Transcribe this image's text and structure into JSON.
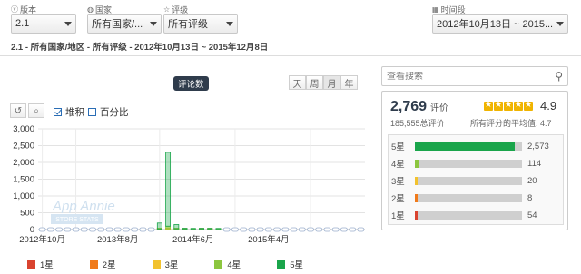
{
  "filters": {
    "version": {
      "label": "版本",
      "icon": "version-icon",
      "value": "2.1"
    },
    "country": {
      "label": "国家",
      "icon": "globe-icon",
      "value": "所有国家/..."
    },
    "rating": {
      "label": "评级",
      "icon": "star-icon",
      "value": "所有评级"
    },
    "period": {
      "label": "时间段",
      "icon": "calendar-icon",
      "value": "2012年10月13日 ~ 2015..."
    }
  },
  "summary_line": "2.1 - 所有国家/地区 - 所有评级 - 2012年10月13日 ~ 2015年12月8日",
  "chart_header": {
    "badge": "评论数",
    "range_buttons": [
      "天",
      "周",
      "月",
      "年"
    ],
    "stacked_label": "堆积",
    "stacked_checked": true,
    "percent_label": "百分比",
    "percent_checked": false
  },
  "watermark": {
    "line1": "App Annie",
    "line2": "STORE STATS"
  },
  "chart_data": {
    "type": "bar",
    "stacked": true,
    "x_tick_labels": [
      "2012年10月",
      "2013年8月",
      "2014年6月",
      "2015年4月"
    ],
    "y_ticks": [
      0,
      500,
      1000,
      1500,
      2000,
      2500,
      3000
    ],
    "y_tick_labels": [
      "0",
      "500",
      "1,000",
      "1,500",
      "2,000",
      "2,500",
      "3,000"
    ],
    "ylim": [
      0,
      3000
    ],
    "grid": true,
    "legend_position": "bottom",
    "colors": {
      "1星": "#d9432f",
      "2星": "#f07a1a",
      "3星": "#f2c22e",
      "4星": "#8cc63f",
      "5星": "#1aa54b"
    },
    "series": [
      {
        "name": "1星",
        "values": [
          0,
          0,
          0,
          0,
          0,
          0,
          0,
          0,
          0,
          0,
          0,
          0,
          0,
          0,
          2,
          5,
          2,
          1,
          0,
          1,
          1,
          0,
          0,
          0,
          0,
          0,
          0,
          0,
          0,
          0,
          0,
          0,
          0,
          0,
          0,
          0,
          0,
          0,
          0
        ]
      },
      {
        "name": "2星",
        "values": [
          0,
          0,
          0,
          0,
          0,
          0,
          0,
          0,
          0,
          0,
          0,
          0,
          0,
          0,
          1,
          3,
          1,
          0,
          0,
          0,
          0,
          0,
          0,
          0,
          0,
          0,
          0,
          0,
          0,
          0,
          0,
          0,
          0,
          0,
          0,
          0,
          0,
          0,
          0
        ]
      },
      {
        "name": "3星",
        "values": [
          0,
          0,
          0,
          0,
          0,
          0,
          0,
          0,
          0,
          0,
          0,
          0,
          0,
          0,
          2,
          12,
          3,
          1,
          0,
          1,
          1,
          0,
          0,
          0,
          0,
          0,
          0,
          0,
          0,
          0,
          0,
          0,
          0,
          0,
          0,
          0,
          0,
          0,
          0
        ]
      },
      {
        "name": "4星",
        "values": [
          0,
          0,
          0,
          0,
          0,
          0,
          0,
          0,
          0,
          0,
          0,
          0,
          0,
          0,
          10,
          80,
          14,
          3,
          2,
          2,
          2,
          1,
          0,
          0,
          0,
          0,
          0,
          0,
          0,
          0,
          0,
          0,
          0,
          0,
          0,
          0,
          0,
          0,
          0
        ]
      },
      {
        "name": "5星",
        "values": [
          0,
          0,
          0,
          0,
          0,
          0,
          0,
          0,
          0,
          0,
          0,
          0,
          0,
          0,
          180,
          2200,
          130,
          30,
          12,
          10,
          8,
          3,
          0,
          0,
          0,
          0,
          0,
          0,
          0,
          0,
          0,
          0,
          0,
          0,
          0,
          0,
          0,
          0,
          0
        ]
      }
    ]
  },
  "search": {
    "placeholder": "查看搜索"
  },
  "ratings_panel": {
    "count": "2,769",
    "count_label": "评价",
    "total_reviews": "185,555总评价",
    "avg_value": "4.9",
    "avg_all_label": "所有评分的平均值: 4.7",
    "stars_filled": 5,
    "rows": [
      {
        "label": "5星",
        "count": "2,573",
        "fraction": 0.93,
        "color": "#1aa54b"
      },
      {
        "label": "4星",
        "count": "114",
        "fraction": 0.04,
        "color": "#8cc63f"
      },
      {
        "label": "3星",
        "count": "20",
        "fraction": 0.015,
        "color": "#f2c22e"
      },
      {
        "label": "2星",
        "count": "8",
        "fraction": 0.008,
        "color": "#f07a1a"
      },
      {
        "label": "1星",
        "count": "54",
        "fraction": 0.02,
        "color": "#d9432f"
      }
    ]
  }
}
